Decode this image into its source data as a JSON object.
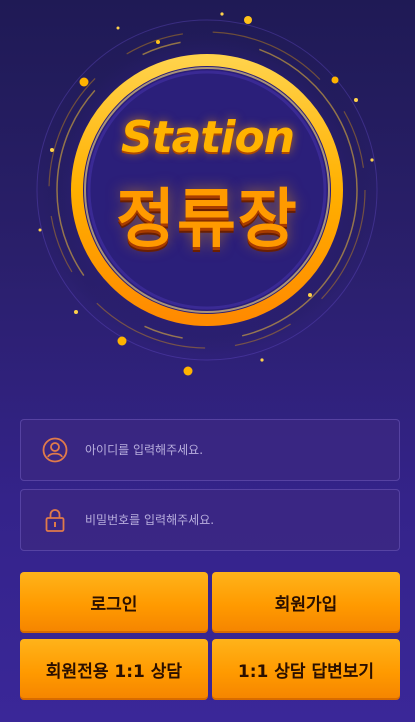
{
  "logo": {
    "wordmark_en": "Station",
    "wordmark_ko": "정류장"
  },
  "login_form": {
    "id_placeholder": "아이디를 입력해주세요.",
    "pw_placeholder": "비밀번호를 입력해주세요.",
    "id_icon": "user-circle-icon",
    "pw_icon": "lock-icon"
  },
  "buttons": {
    "login": "로그인",
    "signup": "회원가입",
    "member_consult": "회원전용 1:1 상담",
    "consult_answers": "1:1 상담 답변보기"
  },
  "colors": {
    "accent": "#ff9a00",
    "background": "#2a1f6b",
    "icon": "#e07a4a"
  }
}
